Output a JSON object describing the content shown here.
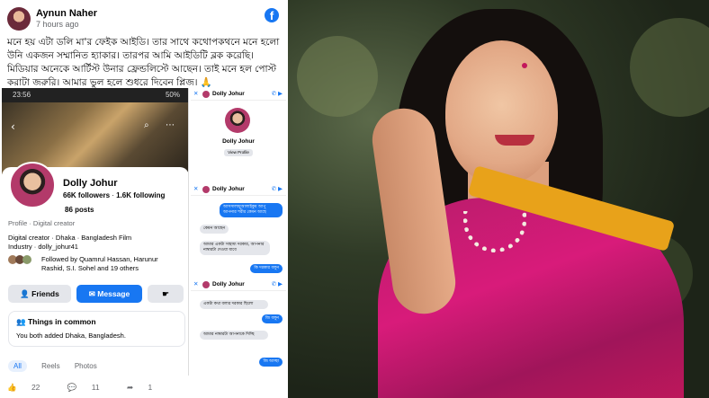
{
  "post": {
    "author": "Aynun Naher",
    "time": "7 hours ago",
    "platform_icon": "facebook-logo-icon",
    "text": "মনে হয় এটা ডলি মা'র ফেইক আইডি। তার সাথে কথোপকথনে মনে হলো উনি একজন সম্মানিত হ্যাকার। তারপর আমি আইডিটি ব্লক করেছি। মিডিয়ার অনেকে আর্টিস্ট উনার ফ্রেন্ডলিস্টে আছেন। তাই মনে হল পোস্ট করাটা জরুরি। আমার ভুল হলে শুধরে দিবেন প্লিজ। 🙏",
    "reactions": {
      "likes": "22",
      "comments": "11",
      "shares": "1"
    }
  },
  "profile_screenshot": {
    "status_time": "23:56",
    "status_right": "50%",
    "name": "Dolly Johur",
    "followers": "66K followers",
    "following": "1.6K following",
    "posts": "86 posts",
    "category": "Profile · Digital creator",
    "details_line1": "Digital creator · Dhaka · Bangladesh Film",
    "details_line2": "Industry · dolly_johur41",
    "followed_by_line1": "Followed by Quamrul Hassan, Harunur",
    "followed_by_line2": "Rashid, S.I. Sohel and 19 others",
    "friends_button": "Friends",
    "message_button": "Message",
    "common_title": "Things in common",
    "common_body": "You both added Dhaka, Bangladesh.",
    "tabs": [
      "All",
      "Reels",
      "Photos"
    ]
  },
  "chat_screenshot": {
    "contact": "Dolly Johur",
    "view_profile": "View Profile",
    "messages": [
      {
        "dir": "out",
        "text": "আসসালামুআলাইকুম আপু আপনার শরীর কেমন আছে"
      },
      {
        "dir": "in",
        "text": "কেমন আছেন"
      },
      {
        "dir": "in",
        "text": "আমার একটা সাহায্য দরকার, আপনার নাম্বারটা দেওয়া যাবে"
      },
      {
        "dir": "out",
        "text": "কি দরকার বলুন"
      },
      {
        "dir": "in",
        "text": "একটা কথা বলার দরকার ছিলো"
      },
      {
        "dir": "out",
        "text": "জি বলুন"
      },
      {
        "dir": "in",
        "text": "আমার নাম্বারটা আপনাকে দিচ্ছি"
      },
      {
        "dir": "out",
        "text": "জি আচ্ছা"
      }
    ]
  }
}
